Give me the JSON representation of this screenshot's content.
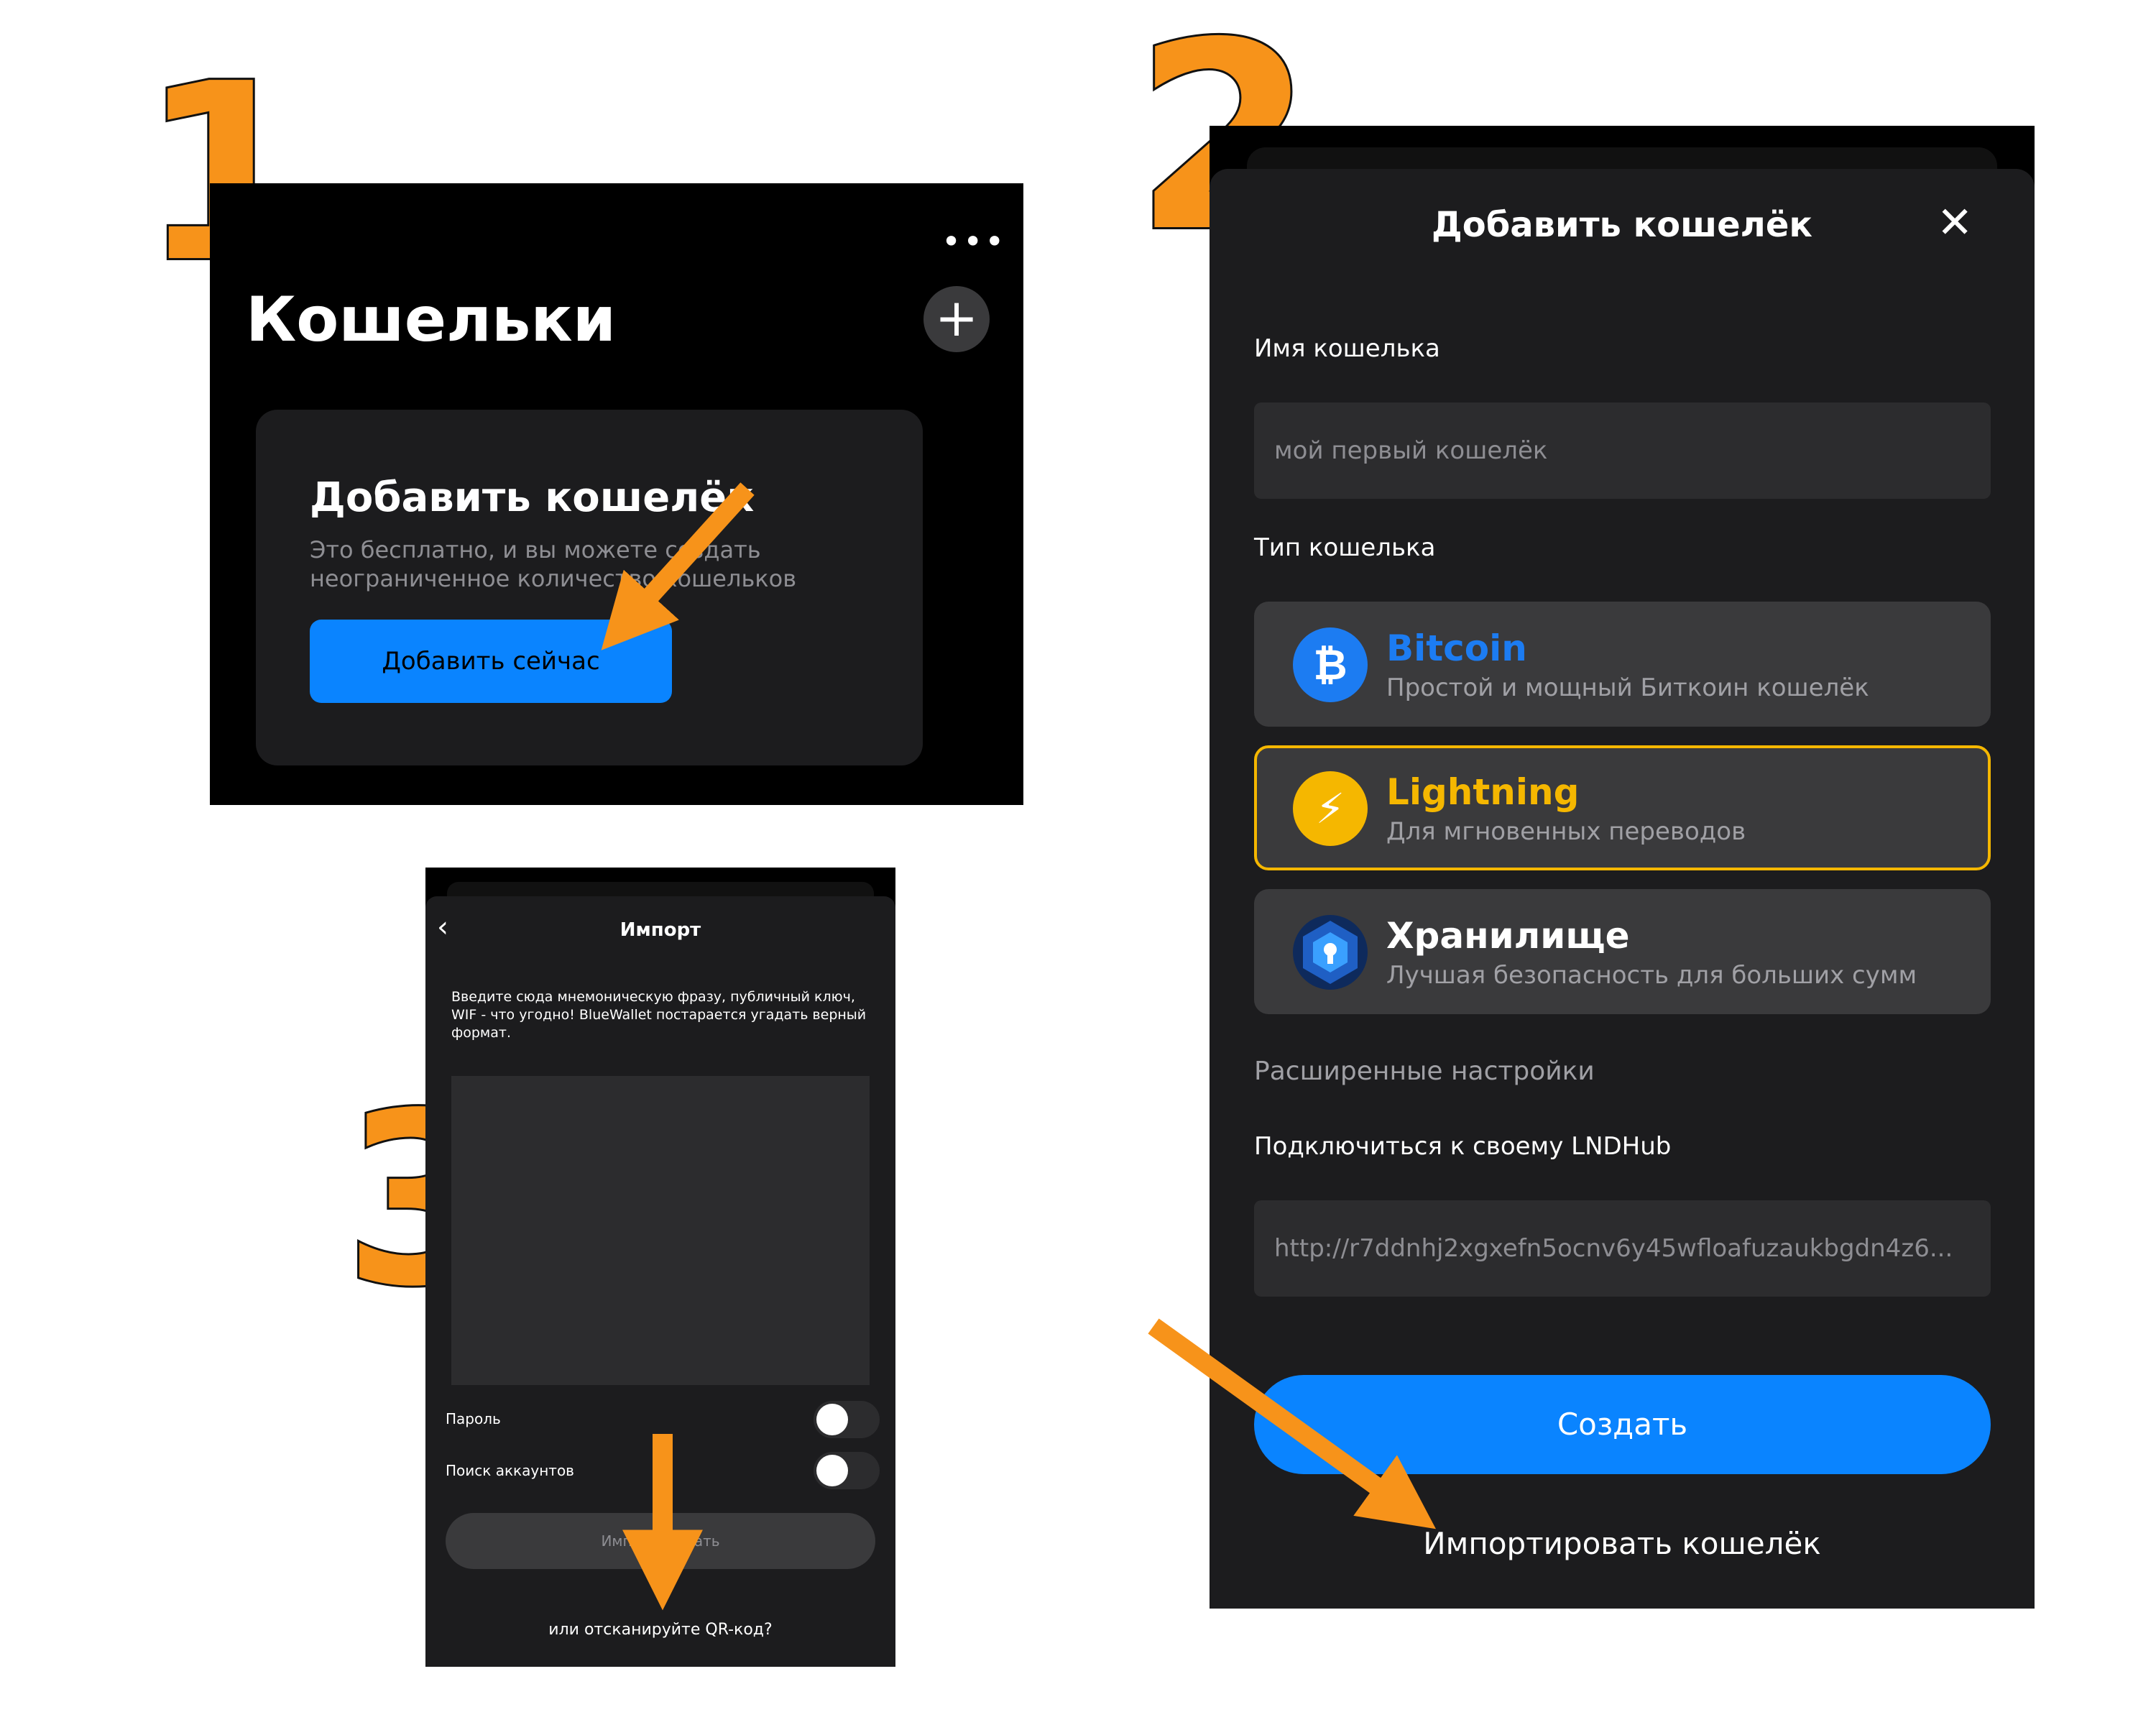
{
  "steps": [
    "1",
    "2",
    "3"
  ],
  "colors": {
    "accent": "#f7931a",
    "blue": "#0a84ff",
    "lightning": "#f5b700"
  },
  "screen1": {
    "more_icon": "more-dots-icon",
    "title": "Кошельки",
    "plus_icon": "plus-icon",
    "card_title": "Добавить кошелёк",
    "card_text": "Это бесплатно, и вы можете создать неограниченное количество кошельков",
    "add_now_button": "Добавить сейчас"
  },
  "screen2": {
    "header_title": "Добавить кошелёк",
    "close_icon": "close-icon",
    "name_label": "Имя кошелька",
    "name_placeholder": "мой первый кошелёк",
    "type_label": "Тип кошелька",
    "options": [
      {
        "title": "Bitcoin",
        "subtitle": "Простой и мощный Биткоин кошелёк",
        "icon": "bitcoin-icon"
      },
      {
        "title": "Lightning",
        "subtitle": "Для мгновенных переводов",
        "icon": "lightning-icon"
      },
      {
        "title": "Хранилище",
        "subtitle": "Лучшая безопасность для больших сумм",
        "icon": "vault-icon"
      }
    ],
    "advanced_label": "Расширенные настройки",
    "lndhub_label": "Подключиться к своему LNDHub",
    "lndhub_value": "http://r7ddnhj2xgxefn5ocnv6y45wfloafuzaukbgdn4z6...",
    "create_button": "Создать",
    "import_link": "Импортировать кошелёк"
  },
  "screen3": {
    "back_icon": "chevron-left-icon",
    "header_title": "Импорт",
    "description": "Введите сюда мнемоническую фразу, публичный ключ, WIF - что угодно! BlueWallet постарается угадать верный формат.",
    "password_label": "Пароль",
    "search_accounts_label": "Поиск аккаунтов",
    "import_button": "Импортировать",
    "scan_qr_link": "или отсканируйте QR-код?"
  }
}
